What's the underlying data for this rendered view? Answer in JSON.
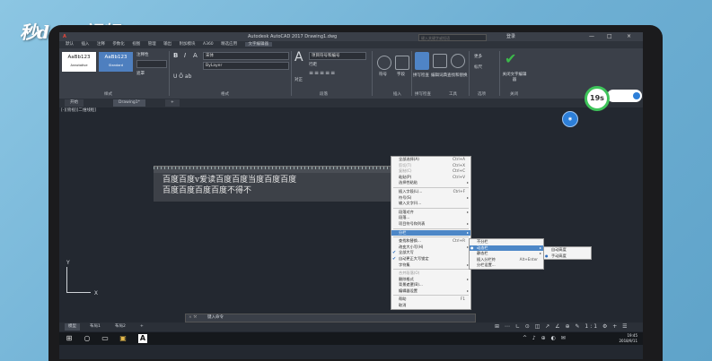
{
  "watermark": "秒dong视频",
  "window": {
    "title": "Autodesk AutoCAD 2017   Drawing1.dwg",
    "search_placeholder": "键入关键字或短语",
    "user": "登录",
    "controls": [
      "—",
      "□",
      "×"
    ]
  },
  "ribbon_tabs": [
    "默认",
    "插入",
    "注释",
    "参数化",
    "视图",
    "管理",
    "输出",
    "附加模块",
    "A360",
    "精选应用",
    "文字编辑器"
  ],
  "ribbon": {
    "style_boxes": [
      {
        "sample": "AaBb123",
        "name": "Annotative"
      },
      {
        "sample": "AaBb123",
        "name": "Standard"
      }
    ],
    "annotative": "注释性",
    "mask": "遮罩",
    "font_combo": "宋体",
    "color_combo": "ByLayer",
    "justify": "对正",
    "paragraph_combo": "项目符号和编号",
    "linespacing": "行距",
    "groups": {
      "style": "样式",
      "format": "格式",
      "paragraph": "段落",
      "insert": "插入",
      "spell": "拼写检查",
      "tools": "工具",
      "options": "选项",
      "close": "关闭"
    },
    "insert_buttons": [
      "符号",
      "字段"
    ],
    "spell_buttons": [
      "拼写检查",
      "编辑词典",
      "查找和替换"
    ],
    "options": [
      "更多",
      "标尺"
    ],
    "close_label": "关闭文字编辑器"
  },
  "doc_tabs": [
    "开始",
    "Drawing1*"
  ],
  "viewport_label": "[-][俯视][二维线框]",
  "mtext": {
    "line1": "百度百度v爱读百度百度当度百度百度",
    "line2": "百度百度百度百度不得不"
  },
  "context_menu": {
    "items": [
      {
        "label": "全部选择(A)",
        "shortcut": "Ctrl+A"
      },
      {
        "label": "剪切(T)",
        "shortcut": "Ctrl+X",
        "disabled": true
      },
      {
        "label": "复制(C)",
        "shortcut": "Ctrl+C",
        "disabled": true
      },
      {
        "label": "粘贴(P)",
        "shortcut": "Ctrl+V"
      },
      {
        "label": "选择性粘贴",
        "arrow": true
      },
      {
        "sep": true
      },
      {
        "label": "插入字段(L)...",
        "shortcut": "Ctrl+F"
      },
      {
        "label": "符号(S)",
        "arrow": true
      },
      {
        "label": "输入文字(I)..."
      },
      {
        "sep": true
      },
      {
        "label": "段落对齐",
        "arrow": true
      },
      {
        "label": "段落..."
      },
      {
        "label": "项目符号和列表",
        "arrow": true
      },
      {
        "sep": true
      },
      {
        "label": "分栏",
        "arrow": true,
        "highlight": true
      },
      {
        "sep": true
      },
      {
        "label": "查找和替换...",
        "shortcut": "Ctrl+R"
      },
      {
        "label": "改变大小写(H)",
        "arrow": true
      },
      {
        "label": "全部大写",
        "checked": true
      },
      {
        "label": "自动更正大写锁定",
        "checked": true
      },
      {
        "label": "字符集",
        "arrow": true
      },
      {
        "sep": true
      },
      {
        "label": "合并段落(O)",
        "disabled": true
      },
      {
        "label": "删除格式",
        "arrow": true
      },
      {
        "label": "背景遮罩(B)..."
      },
      {
        "label": "编辑器设置",
        "arrow": true
      },
      {
        "sep": true
      },
      {
        "label": "帮助",
        "shortcut": "F1"
      },
      {
        "label": "取消"
      }
    ]
  },
  "columns_menu": {
    "items": [
      {
        "label": "不分栏"
      },
      {
        "label": "动态栏",
        "arrow": true,
        "highlight": true,
        "dot": true
      },
      {
        "label": "静态栏",
        "arrow": true
      },
      {
        "label": "插入分栏符",
        "shortcut": "Alt+Enter"
      },
      {
        "label": "分栏设置..."
      }
    ]
  },
  "dynamic_menu": {
    "items": [
      {
        "label": "自动高度"
      },
      {
        "label": "手动高度",
        "dot": true
      }
    ]
  },
  "command_line": "键入命令",
  "layout_tabs": [
    "模型",
    "布局1",
    "布局2"
  ],
  "status_icons": "⊞ ⋯ ∟ ⊙ ◫ ↗ ∠ ⊕ ✎ 1:1 ⚙ + ☰",
  "timer": {
    "value": "19s"
  },
  "taskbar": {
    "time": "19:45",
    "date": "2018/9/11"
  }
}
